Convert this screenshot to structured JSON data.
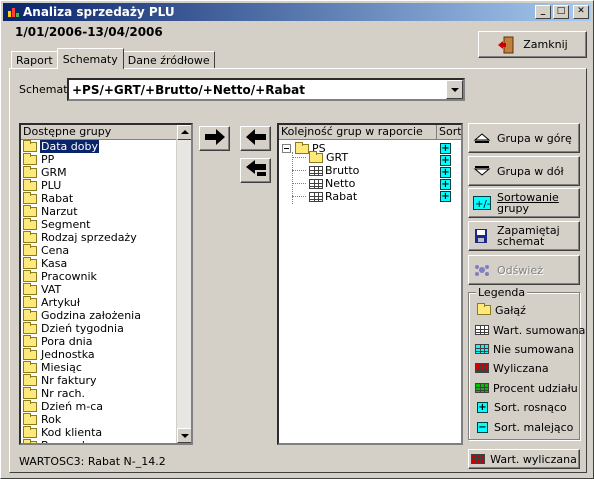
{
  "window": {
    "title": "Analiza sprzedaży PLU"
  },
  "title_buttons": {
    "minimize": "_",
    "maximize": "□",
    "close": "✕"
  },
  "header": {
    "date_range": "1/01/2006-13/04/2006",
    "close_label": "Zamknij"
  },
  "tabs": [
    {
      "label": "Raport",
      "active": false
    },
    {
      "label": "Schematy",
      "active": true
    },
    {
      "label": "Dane źródłowe",
      "active": false
    }
  ],
  "schema": {
    "label": "Schemat:",
    "value": "+PS/+GRT/+Brutto/+Netto/+Rabat"
  },
  "available_groups": {
    "header": "Dostępne grupy",
    "items": [
      "Data doby",
      "PP",
      "GRM",
      "PLU",
      "Rabat",
      "Narzut",
      "Segment",
      "Rodzaj sprzedaży",
      "Cena",
      "Kasa",
      "Pracownik",
      "VAT",
      "Artykuł",
      "Godzina założenia",
      "Dzień tygodnia",
      "Pora dnia",
      "Jednostka",
      "Miesiąc",
      "Nr faktury",
      "Nr rach.",
      "Dzień m-ca",
      "Rok",
      "Kod klienta",
      "Bez rach."
    ],
    "selected_index": 0
  },
  "order_groups": {
    "header": "Kolejność grup w raporcie",
    "sort_header": "Sort.",
    "root": "PS",
    "children": [
      {
        "label": "GRT",
        "icon": "folder-icon"
      },
      {
        "label": "Brutto",
        "icon": "table-icon"
      },
      {
        "label": "Netto",
        "icon": "table-icon"
      },
      {
        "label": "Rabat",
        "icon": "table-icon"
      }
    ],
    "sort_marks": [
      "+",
      "+",
      "+",
      "+",
      "+"
    ]
  },
  "side_buttons": {
    "group_up": "Grupa w górę",
    "group_down": "Grupa w dół",
    "sorting_1": "Sortowanie",
    "sorting_2": "grupy",
    "save_1": "Zapamiętaj",
    "save_2": "schemat",
    "refresh": "Odśwież"
  },
  "legend": {
    "title": "Legenda",
    "items": [
      "Gałąź",
      "Wart. sumowana",
      "Nie sumowana",
      "Wyliczana",
      "Procent udziału",
      "Sort. rosnąco",
      "Sort. malejąco"
    ],
    "colors": {
      "folder": "#ffe97a",
      "sum": "#ffffff",
      "nosum": "#00ffff",
      "calc": "#cc0000",
      "percent": "#00c000",
      "sort": "#00ffff"
    }
  },
  "status": {
    "text": "WARTOSC3:  Rabat  N-_14.2"
  },
  "wart_button": "Wart. wyliczana"
}
